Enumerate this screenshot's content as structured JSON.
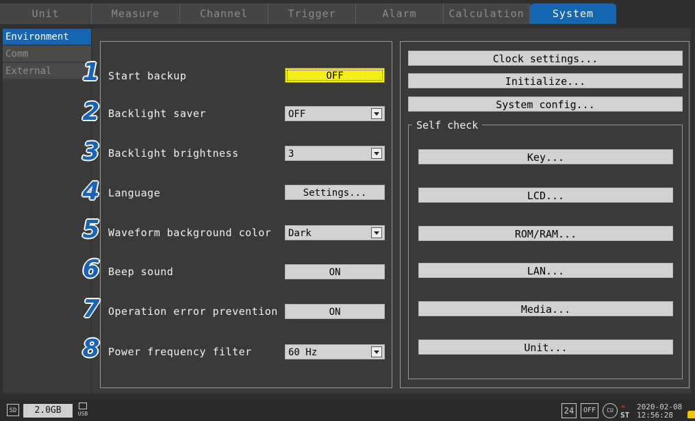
{
  "tabs": [
    "Unit",
    "Measure",
    "Channel",
    "Trigger",
    "Alarm",
    "Calculation",
    "System"
  ],
  "sidebar": [
    "Environment",
    "Comm",
    "External"
  ],
  "settings": [
    {
      "num": "1",
      "label": "Start backup",
      "value": "OFF",
      "kind": "button-highlight"
    },
    {
      "num": "2",
      "label": "Backlight saver",
      "value": "OFF",
      "kind": "select"
    },
    {
      "num": "3",
      "label": "Backlight brightness",
      "value": "3",
      "kind": "select"
    },
    {
      "num": "4",
      "label": "Language",
      "value": "Settings...",
      "kind": "button"
    },
    {
      "num": "5",
      "label": "Waveform background color",
      "value": "Dark",
      "kind": "select"
    },
    {
      "num": "6",
      "label": "Beep sound",
      "value": "ON",
      "kind": "button"
    },
    {
      "num": "7",
      "label": "Operation error prevention",
      "value": "ON",
      "kind": "button"
    },
    {
      "num": "8",
      "label": "Power frequency filter",
      "value": "60 Hz",
      "kind": "select"
    }
  ],
  "right_buttons": [
    "Clock settings...",
    "Initialize...",
    "System config..."
  ],
  "self_check": {
    "title": "Self check",
    "buttons": [
      "Key...",
      "LCD...",
      "ROM/RAM...",
      "LAN...",
      "Media...",
      "Unit..."
    ]
  },
  "status": {
    "sd_label": "SD",
    "capacity": "2.0GB",
    "usb_label": "USB",
    "box_24": "24",
    "box_off": "OFF",
    "round_icon": "CU",
    "st_label": "ST",
    "date": "2020-02-08",
    "time": "12:56:28"
  }
}
